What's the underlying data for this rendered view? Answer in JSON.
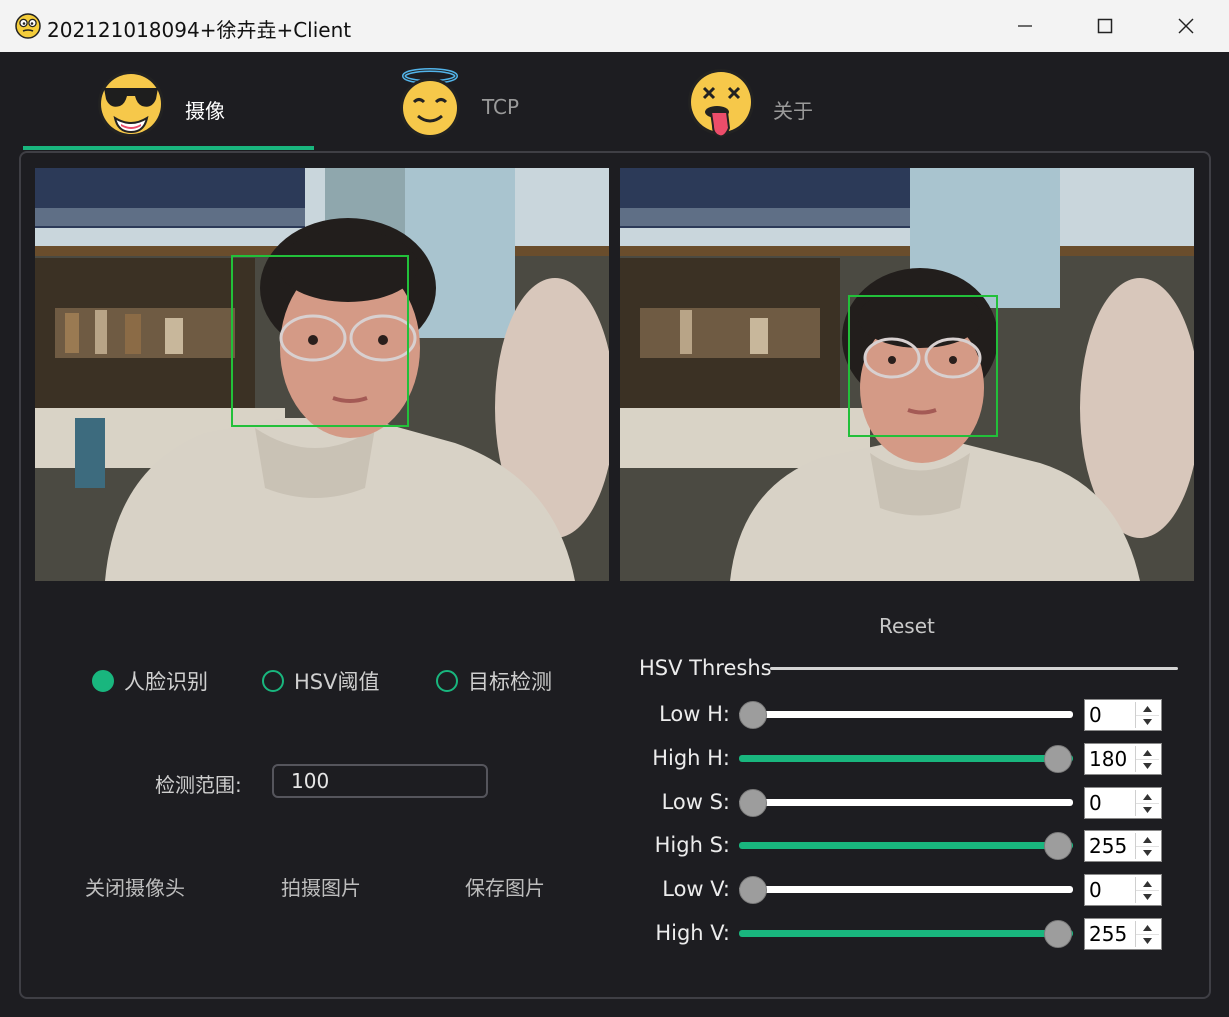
{
  "window": {
    "title": "202121018094+徐卉垚+Client"
  },
  "tabs": [
    {
      "label": "摄像",
      "icon": "sunglasses-emoji-icon",
      "active": true
    },
    {
      "label": "TCP",
      "icon": "halo-emoji-icon",
      "active": false
    },
    {
      "label": "关于",
      "icon": "tongue-out-emoji-icon",
      "active": false
    }
  ],
  "detection_modes": [
    {
      "label": "人脸识别",
      "checked": true
    },
    {
      "label": "HSV阈值",
      "checked": false
    },
    {
      "label": "目标检测",
      "checked": false
    }
  ],
  "range": {
    "label": "检测范围:",
    "value": "100"
  },
  "actions": [
    {
      "label": "关闭摄像头"
    },
    {
      "label": "拍摄图片"
    },
    {
      "label": "保存图片"
    }
  ],
  "hsv": {
    "reset_label": "Reset",
    "group_title": "HSV Threshs",
    "max": {
      "h": 180,
      "s": 255,
      "v": 255
    },
    "sliders": [
      {
        "label": "Low H:",
        "value": "0",
        "fraction": 0
      },
      {
        "label": "High H:",
        "value": "180",
        "fraction": 1
      },
      {
        "label": "Low S:",
        "value": "0",
        "fraction": 0
      },
      {
        "label": "High S:",
        "value": "255",
        "fraction": 1
      },
      {
        "label": "Low V:",
        "value": "0",
        "fraction": 0
      },
      {
        "label": "High V:",
        "value": "255",
        "fraction": 1
      }
    ]
  },
  "colors": {
    "accent": "#19b67e",
    "background": "#1d1d21",
    "titlebar": "#f3f3f3"
  }
}
